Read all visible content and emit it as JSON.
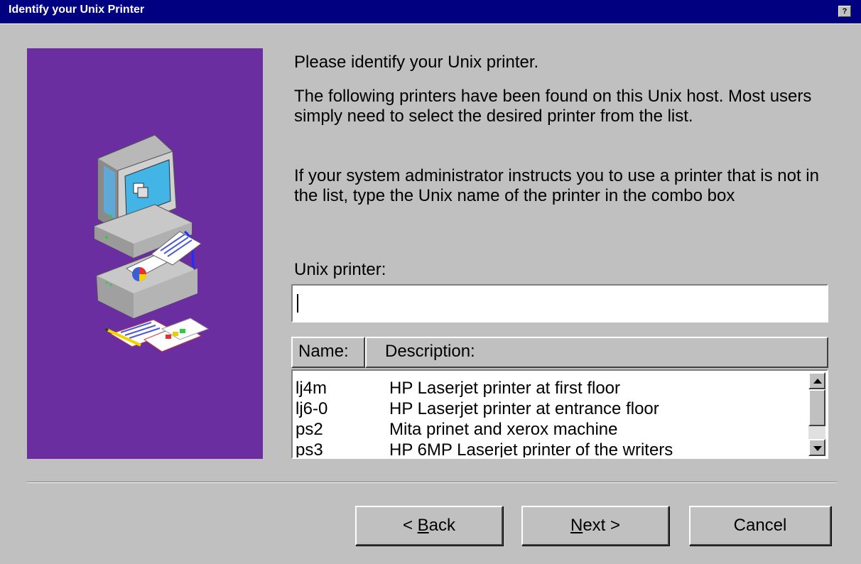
{
  "window": {
    "title": "Identify your Unix Printer",
    "help_label": "?"
  },
  "intro": {
    "heading": "Please identify your Unix printer.",
    "paragraph1": "The following printers have been found on this Unix host. Most users simply need to select the desired printer from the list.",
    "paragraph2": "If your system administrator instructs you to use a printer that is not in the list, type the Unix name of the printer in the combo box"
  },
  "printer_field": {
    "label": "Unix printer:",
    "value": ""
  },
  "list": {
    "columns": [
      "Name:",
      "Description:"
    ],
    "rows": [
      {
        "name": "lj4m",
        "description": "HP Laserjet printer at first floor"
      },
      {
        "name": "lj6-0",
        "description": "HP Laserjet printer at entrance floor"
      },
      {
        "name": "ps2",
        "description": "Mita prinet and xerox machine"
      },
      {
        "name": "ps3",
        "description": "HP 6MP Laserjet printer of the writers"
      }
    ]
  },
  "buttons": {
    "back": {
      "prefix": "< ",
      "mnemonic": "B",
      "rest": "ack"
    },
    "next": {
      "mnemonic": "N",
      "rest": "ext >"
    },
    "cancel": "Cancel"
  },
  "colors": {
    "titlebar": "#000080",
    "panel": "#6a2ea1",
    "dialog": "#c0c0c0"
  }
}
